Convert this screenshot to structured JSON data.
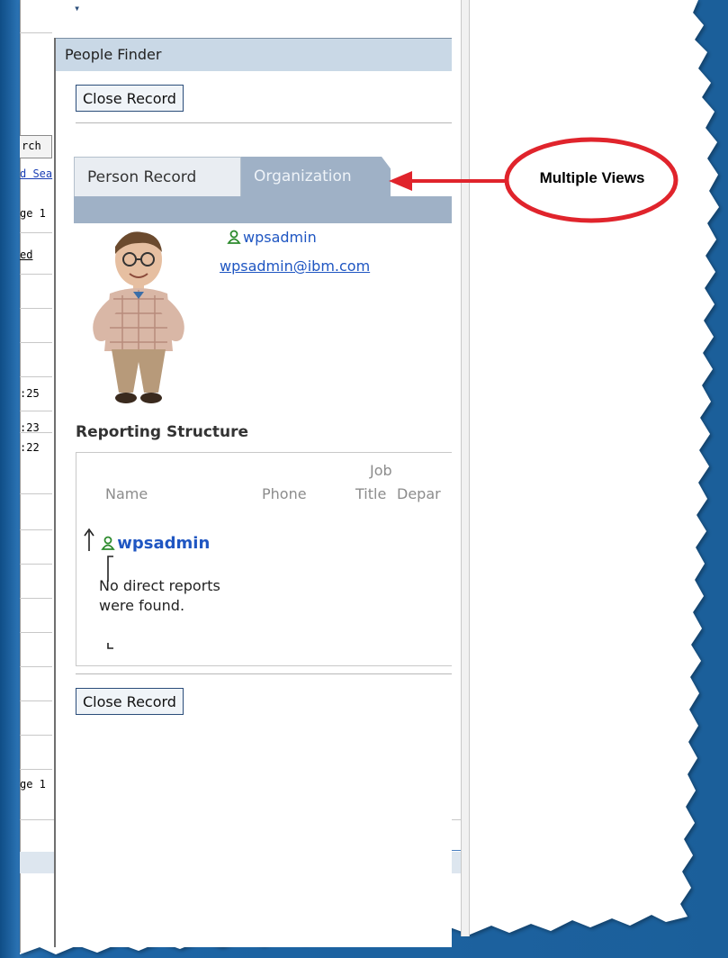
{
  "background_page": {
    "dropdown_arrow": "▾",
    "search_button_fragment": "rch",
    "advanced_link_fragment": "d Sea",
    "page_top_fragment": "ge 1",
    "sort_link_fragment": "ed",
    "times": [
      ":25",
      ":23",
      ":22"
    ],
    "page_bottom_fragment": "ge 1"
  },
  "people_finder": {
    "title": "People Finder",
    "close_record_top": "Close Record",
    "close_record_bottom": "Close Record",
    "tabs": [
      {
        "label": "Person Record",
        "selected": false
      },
      {
        "label": "Organization",
        "selected": true
      }
    ],
    "person": {
      "name": "wpsadmin",
      "email": "wpsadmin@ibm.com",
      "photo": "person-photo"
    },
    "reporting_structure": {
      "title": "Reporting Structure",
      "columns": {
        "name": "Name",
        "phone": "Phone",
        "job_title_line1": "Job",
        "job_title_line2": "Title",
        "department_fragment": "Depar"
      },
      "manager": "wpsadmin",
      "no_reports_message": "No direct reports were found."
    }
  },
  "annotation": {
    "label": "Multiple Views",
    "circle_color": "#e0242c",
    "arrow_color": "#e0242c"
  },
  "colors": {
    "slide_blue": "#1b5f9a",
    "header_blue": "#c9d8e6",
    "tab_blue": "#9fb1c6",
    "link_blue": "#1f56c2"
  }
}
